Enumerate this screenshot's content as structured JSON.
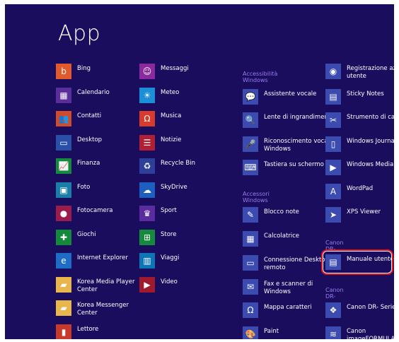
{
  "screen_title": "App",
  "col1": [
    {
      "label": "Bing",
      "icon": "bing-icon",
      "color": "#e25a2c",
      "glyph": "b"
    },
    {
      "label": "Calendario",
      "icon": "calendar-icon",
      "color": "#5b2d9c",
      "glyph": "▦"
    },
    {
      "label": "Contatti",
      "icon": "people-icon",
      "color": "#d04b28",
      "glyph": "👥"
    },
    {
      "label": "Desktop",
      "icon": "desktop-icon",
      "color": "#2a4fa8",
      "glyph": "▭"
    },
    {
      "label": "Finanza",
      "icon": "finance-chart-icon",
      "color": "#138a3c",
      "glyph": "📈"
    },
    {
      "label": "Foto",
      "icon": "photo-icon",
      "color": "#1a7fa8",
      "glyph": "▣"
    },
    {
      "label": "Fotocamera",
      "icon": "camera-icon",
      "color": "#9b1b4b",
      "glyph": "●"
    },
    {
      "label": "Giochi",
      "icon": "games-controller-icon",
      "color": "#128a39",
      "glyph": "✚"
    },
    {
      "label": "Internet Explorer",
      "icon": "ie-icon",
      "color": "#1d6dc7",
      "glyph": "e"
    },
    {
      "label": "Korea Media Player Center",
      "icon": "folder-icon",
      "color": "#e8b64a",
      "glyph": "▰"
    },
    {
      "label": "Korea Messenger Center",
      "icon": "folder-icon",
      "color": "#e8b64a",
      "glyph": "▰"
    },
    {
      "label": "Lettore",
      "icon": "reader-icon",
      "color": "#c7392b",
      "glyph": "▮"
    }
  ],
  "col2": [
    {
      "label": "Messaggi",
      "icon": "messaging-icon",
      "color": "#8a2a9e",
      "glyph": "☺"
    },
    {
      "label": "Meteo",
      "icon": "weather-sun-icon",
      "color": "#1a8fd6",
      "glyph": "☀"
    },
    {
      "label": "Musica",
      "icon": "music-headphones-icon",
      "color": "#d83b2c",
      "glyph": "Ω"
    },
    {
      "label": "Notizie",
      "icon": "news-icon",
      "color": "#b11f34",
      "glyph": "☰"
    },
    {
      "label": "Recycle Bin",
      "icon": "recycle-bin-icon",
      "color": "#2e3f9a",
      "glyph": "♻"
    },
    {
      "label": "SkyDrive",
      "icon": "cloud-icon",
      "color": "#1c5fc0",
      "glyph": "☁"
    },
    {
      "label": "Sport",
      "icon": "trophy-icon",
      "color": "#5a2ca0",
      "glyph": "♛"
    },
    {
      "label": "Store",
      "icon": "store-bag-icon",
      "color": "#138a3c",
      "glyph": "⊞"
    },
    {
      "label": "Viaggi",
      "icon": "travel-suitcase-icon",
      "color": "#0d74b6",
      "glyph": "▥"
    },
    {
      "label": "Video",
      "icon": "video-play-icon",
      "color": "#9e1a2e",
      "glyph": "▶"
    }
  ],
  "col3": [
    {
      "type": "group",
      "label": "Accessibilità Windows"
    },
    {
      "label": "Assistente vocale",
      "icon": "narrator-icon",
      "color": "#3b4bb0",
      "glyph": "💬"
    },
    {
      "label": "Lente di ingrandimento",
      "icon": "magnifier-icon",
      "color": "#3b4bb0",
      "glyph": "🔍"
    },
    {
      "label": "Riconoscimento vocale Windows",
      "icon": "microphone-icon",
      "color": "#3b4bb0",
      "glyph": "🎤"
    },
    {
      "label": "Tastiera su schermo",
      "icon": "keyboard-icon",
      "color": "#3b4bb0",
      "glyph": "⌨"
    },
    {
      "type": "group",
      "label": "Accessori Windows"
    },
    {
      "label": "Blocco note",
      "icon": "notepad-icon",
      "color": "#3b4bb0",
      "glyph": "✎"
    },
    {
      "label": "Calcolatrice",
      "icon": "calculator-icon",
      "color": "#3b4bb0",
      "glyph": "▦"
    },
    {
      "label": "Connessione Desktop remoto",
      "icon": "remote-desktop-icon",
      "color": "#3b4bb0",
      "glyph": "▭"
    },
    {
      "label": "Fax e scanner di Windows",
      "icon": "fax-scanner-icon",
      "color": "#3b4bb0",
      "glyph": "✉"
    },
    {
      "label": "Mappa caratteri",
      "icon": "character-map-icon",
      "color": "#3b4bb0",
      "glyph": "Ω"
    },
    {
      "label": "Paint",
      "icon": "paint-icon",
      "color": "#3b4bb0",
      "glyph": "🎨"
    }
  ],
  "col4": [
    {
      "label": "Registrazione azioni utente",
      "icon": "steps-recorder-icon",
      "color": "#3b4bb0",
      "glyph": "◉"
    },
    {
      "label": "Sticky Notes",
      "icon": "sticky-notes-icon",
      "color": "#3b4bb0",
      "glyph": "▤"
    },
    {
      "label": "Strumento di cattura",
      "icon": "snipping-tool-icon",
      "color": "#3b4bb0",
      "glyph": "✂"
    },
    {
      "label": "Windows Journal",
      "icon": "journal-icon",
      "color": "#3b4bb0",
      "glyph": "▯"
    },
    {
      "label": "Windows Media Player",
      "icon": "media-player-icon",
      "color": "#3b4bb0",
      "glyph": "▶"
    },
    {
      "label": "WordPad",
      "icon": "wordpad-icon",
      "color": "#3b4bb0",
      "glyph": "A"
    },
    {
      "label": "XPS Viewer",
      "icon": "xps-viewer-icon",
      "color": "#3b4bb0",
      "glyph": "➤"
    },
    {
      "type": "group",
      "label": "Canon DR-"
    },
    {
      "label": "Manuale utente",
      "icon": "manual-document-icon",
      "color": "#3b4bb0",
      "glyph": "▤"
    },
    {
      "type": "group",
      "label": "Canon DR-"
    },
    {
      "label": "Canon DR- Serie Guida",
      "icon": "guide-book-icon",
      "color": "#3b4bb0",
      "glyph": "❖"
    },
    {
      "label": "Canon imageFORMULA...",
      "icon": "canon-app-icon",
      "color": "#3b4bb0",
      "glyph": "≋"
    }
  ]
}
